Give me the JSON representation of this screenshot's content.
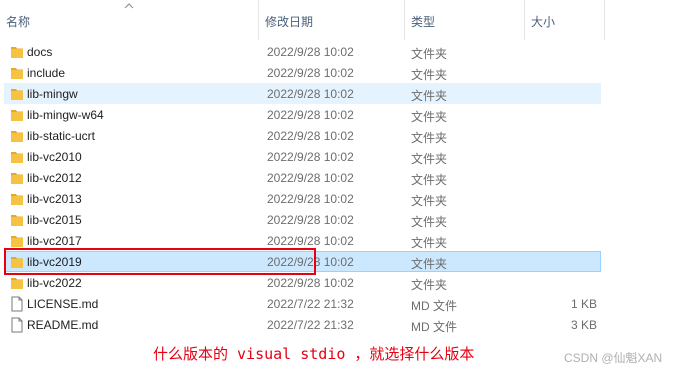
{
  "columns": {
    "name": "名称",
    "date_modified": "修改日期",
    "type": "类型",
    "size": "大小"
  },
  "files": [
    {
      "name": "docs",
      "date": "2022/9/28 10:02",
      "type": "文件夹",
      "size": "",
      "icon": "folder-icon",
      "state": "normal"
    },
    {
      "name": "include",
      "date": "2022/9/28 10:02",
      "type": "文件夹",
      "size": "",
      "icon": "folder-icon",
      "state": "normal"
    },
    {
      "name": "lib-mingw",
      "date": "2022/9/28 10:02",
      "type": "文件夹",
      "size": "",
      "icon": "folder-icon",
      "state": "hover"
    },
    {
      "name": "lib-mingw-w64",
      "date": "2022/9/28 10:02",
      "type": "文件夹",
      "size": "",
      "icon": "folder-icon",
      "state": "normal"
    },
    {
      "name": "lib-static-ucrt",
      "date": "2022/9/28 10:02",
      "type": "文件夹",
      "size": "",
      "icon": "folder-icon",
      "state": "normal"
    },
    {
      "name": "lib-vc2010",
      "date": "2022/9/28 10:02",
      "type": "文件夹",
      "size": "",
      "icon": "folder-icon",
      "state": "normal"
    },
    {
      "name": "lib-vc2012",
      "date": "2022/9/28 10:02",
      "type": "文件夹",
      "size": "",
      "icon": "folder-icon",
      "state": "normal"
    },
    {
      "name": "lib-vc2013",
      "date": "2022/9/28 10:02",
      "type": "文件夹",
      "size": "",
      "icon": "folder-icon",
      "state": "normal"
    },
    {
      "name": "lib-vc2015",
      "date": "2022/9/28 10:02",
      "type": "文件夹",
      "size": "",
      "icon": "folder-icon",
      "state": "normal"
    },
    {
      "name": "lib-vc2017",
      "date": "2022/9/28 10:02",
      "type": "文件夹",
      "size": "",
      "icon": "folder-icon",
      "state": "normal"
    },
    {
      "name": "lib-vc2019",
      "date": "2022/9/28 10:02",
      "type": "文件夹",
      "size": "",
      "icon": "folder-icon",
      "state": "selected"
    },
    {
      "name": "lib-vc2022",
      "date": "2022/9/28 10:02",
      "type": "文件夹",
      "size": "",
      "icon": "folder-icon",
      "state": "normal"
    },
    {
      "name": "LICENSE.md",
      "date": "2022/7/22 21:32",
      "type": "MD 文件",
      "size": "1 KB",
      "icon": "document-icon",
      "state": "normal"
    },
    {
      "name": "README.md",
      "date": "2022/7/22 21:32",
      "type": "MD 文件",
      "size": "3 KB",
      "icon": "document-icon",
      "state": "normal"
    }
  ],
  "annotation": "什么版本的 visual stdio ，就选择什么版本",
  "watermark": "CSDN @仙魁XAN",
  "colors": {
    "folder": "#f5c242",
    "folder_tab": "#e4a82a",
    "selected_bg": "#cce8ff",
    "hover_bg": "#e5f3ff",
    "annotation_red": "#e60012"
  }
}
